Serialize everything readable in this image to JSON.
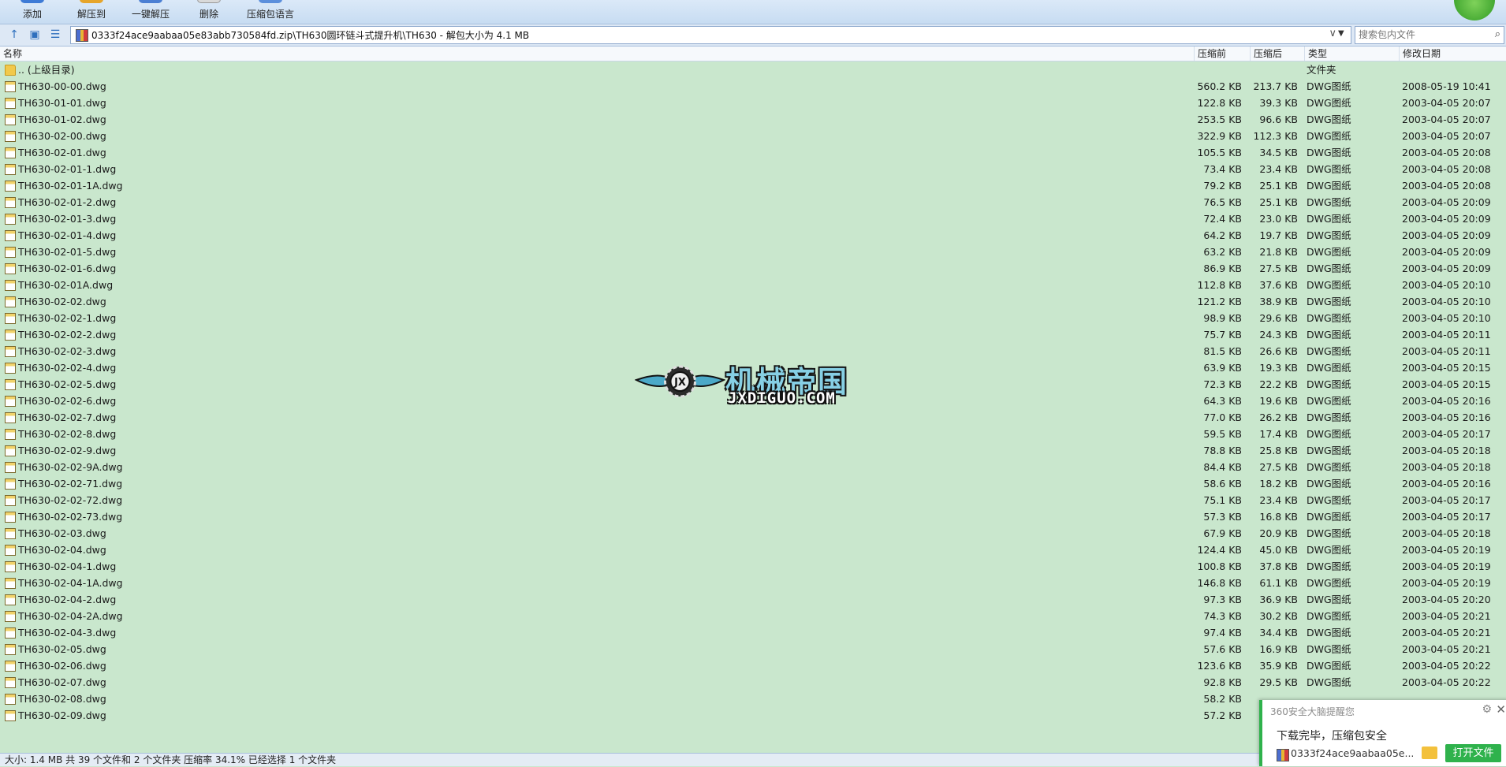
{
  "toolbar": {
    "buttons": [
      {
        "label": "添加",
        "icon": "add-icon"
      },
      {
        "label": "解压到",
        "icon": "extract-to-icon"
      },
      {
        "label": "一键解压",
        "icon": "one-click-extract-icon"
      },
      {
        "label": "删除",
        "icon": "delete-icon"
      },
      {
        "label": "压缩包语言",
        "icon": "archive-language-icon"
      }
    ]
  },
  "address": {
    "path": "0333f24ace9aabaa05e83abb730584fd.zip\\TH630圆环链斗式提升机\\TH630 - 解包大小为 4.1 MB",
    "search_placeholder": "搜索包内文件"
  },
  "columns": {
    "name": "名称",
    "packed": "压缩前",
    "compressed": "压缩后",
    "type": "类型",
    "modified": "修改日期"
  },
  "parent_row": {
    "name": ".. (上级目录)",
    "type": "文件夹"
  },
  "files": [
    {
      "name": "TH630-00-00.dwg",
      "packed": "560.2 KB",
      "compressed": "213.7 KB",
      "type": "DWG图纸",
      "modified": "2008-05-19 10:41"
    },
    {
      "name": "TH630-01-01.dwg",
      "packed": "122.8 KB",
      "compressed": "39.3 KB",
      "type": "DWG图纸",
      "modified": "2003-04-05 20:07"
    },
    {
      "name": "TH630-01-02.dwg",
      "packed": "253.5 KB",
      "compressed": "96.6 KB",
      "type": "DWG图纸",
      "modified": "2003-04-05 20:07"
    },
    {
      "name": "TH630-02-00.dwg",
      "packed": "322.9 KB",
      "compressed": "112.3 KB",
      "type": "DWG图纸",
      "modified": "2003-04-05 20:07"
    },
    {
      "name": "TH630-02-01.dwg",
      "packed": "105.5 KB",
      "compressed": "34.5 KB",
      "type": "DWG图纸",
      "modified": "2003-04-05 20:08"
    },
    {
      "name": "TH630-02-01-1.dwg",
      "packed": "73.4 KB",
      "compressed": "23.4 KB",
      "type": "DWG图纸",
      "modified": "2003-04-05 20:08"
    },
    {
      "name": "TH630-02-01-1A.dwg",
      "packed": "79.2 KB",
      "compressed": "25.1 KB",
      "type": "DWG图纸",
      "modified": "2003-04-05 20:08"
    },
    {
      "name": "TH630-02-01-2.dwg",
      "packed": "76.5 KB",
      "compressed": "25.1 KB",
      "type": "DWG图纸",
      "modified": "2003-04-05 20:09"
    },
    {
      "name": "TH630-02-01-3.dwg",
      "packed": "72.4 KB",
      "compressed": "23.0 KB",
      "type": "DWG图纸",
      "modified": "2003-04-05 20:09"
    },
    {
      "name": "TH630-02-01-4.dwg",
      "packed": "64.2 KB",
      "compressed": "19.7 KB",
      "type": "DWG图纸",
      "modified": "2003-04-05 20:09"
    },
    {
      "name": "TH630-02-01-5.dwg",
      "packed": "63.2 KB",
      "compressed": "21.8 KB",
      "type": "DWG图纸",
      "modified": "2003-04-05 20:09"
    },
    {
      "name": "TH630-02-01-6.dwg",
      "packed": "86.9 KB",
      "compressed": "27.5 KB",
      "type": "DWG图纸",
      "modified": "2003-04-05 20:09"
    },
    {
      "name": "TH630-02-01A.dwg",
      "packed": "112.8 KB",
      "compressed": "37.6 KB",
      "type": "DWG图纸",
      "modified": "2003-04-05 20:10"
    },
    {
      "name": "TH630-02-02.dwg",
      "packed": "121.2 KB",
      "compressed": "38.9 KB",
      "type": "DWG图纸",
      "modified": "2003-04-05 20:10"
    },
    {
      "name": "TH630-02-02-1.dwg",
      "packed": "98.9 KB",
      "compressed": "29.6 KB",
      "type": "DWG图纸",
      "modified": "2003-04-05 20:10"
    },
    {
      "name": "TH630-02-02-2.dwg",
      "packed": "75.7 KB",
      "compressed": "24.3 KB",
      "type": "DWG图纸",
      "modified": "2003-04-05 20:11"
    },
    {
      "name": "TH630-02-02-3.dwg",
      "packed": "81.5 KB",
      "compressed": "26.6 KB",
      "type": "DWG图纸",
      "modified": "2003-04-05 20:11"
    },
    {
      "name": "TH630-02-02-4.dwg",
      "packed": "63.9 KB",
      "compressed": "19.3 KB",
      "type": "DWG图纸",
      "modified": "2003-04-05 20:15"
    },
    {
      "name": "TH630-02-02-5.dwg",
      "packed": "72.3 KB",
      "compressed": "22.2 KB",
      "type": "DWG图纸",
      "modified": "2003-04-05 20:15"
    },
    {
      "name": "TH630-02-02-6.dwg",
      "packed": "64.3 KB",
      "compressed": "19.6 KB",
      "type": "DWG图纸",
      "modified": "2003-04-05 20:16"
    },
    {
      "name": "TH630-02-02-7.dwg",
      "packed": "77.0 KB",
      "compressed": "26.2 KB",
      "type": "DWG图纸",
      "modified": "2003-04-05 20:16"
    },
    {
      "name": "TH630-02-02-8.dwg",
      "packed": "59.5 KB",
      "compressed": "17.4 KB",
      "type": "DWG图纸",
      "modified": "2003-04-05 20:17"
    },
    {
      "name": "TH630-02-02-9.dwg",
      "packed": "78.8 KB",
      "compressed": "25.8 KB",
      "type": "DWG图纸",
      "modified": "2003-04-05 20:18"
    },
    {
      "name": "TH630-02-02-9A.dwg",
      "packed": "84.4 KB",
      "compressed": "27.5 KB",
      "type": "DWG图纸",
      "modified": "2003-04-05 20:18"
    },
    {
      "name": "TH630-02-02-71.dwg",
      "packed": "58.6 KB",
      "compressed": "18.2 KB",
      "type": "DWG图纸",
      "modified": "2003-04-05 20:16"
    },
    {
      "name": "TH630-02-02-72.dwg",
      "packed": "75.1 KB",
      "compressed": "23.4 KB",
      "type": "DWG图纸",
      "modified": "2003-04-05 20:17"
    },
    {
      "name": "TH630-02-02-73.dwg",
      "packed": "57.3 KB",
      "compressed": "16.8 KB",
      "type": "DWG图纸",
      "modified": "2003-04-05 20:17"
    },
    {
      "name": "TH630-02-03.dwg",
      "packed": "67.9 KB",
      "compressed": "20.9 KB",
      "type": "DWG图纸",
      "modified": "2003-04-05 20:18"
    },
    {
      "name": "TH630-02-04.dwg",
      "packed": "124.4 KB",
      "compressed": "45.0 KB",
      "type": "DWG图纸",
      "modified": "2003-04-05 20:19"
    },
    {
      "name": "TH630-02-04-1.dwg",
      "packed": "100.8 KB",
      "compressed": "37.8 KB",
      "type": "DWG图纸",
      "modified": "2003-04-05 20:19"
    },
    {
      "name": "TH630-02-04-1A.dwg",
      "packed": "146.8 KB",
      "compressed": "61.1 KB",
      "type": "DWG图纸",
      "modified": "2003-04-05 20:19"
    },
    {
      "name": "TH630-02-04-2.dwg",
      "packed": "97.3 KB",
      "compressed": "36.9 KB",
      "type": "DWG图纸",
      "modified": "2003-04-05 20:20"
    },
    {
      "name": "TH630-02-04-2A.dwg",
      "packed": "74.3 KB",
      "compressed": "30.2 KB",
      "type": "DWG图纸",
      "modified": "2003-04-05 20:21"
    },
    {
      "name": "TH630-02-04-3.dwg",
      "packed": "97.4 KB",
      "compressed": "34.4 KB",
      "type": "DWG图纸",
      "modified": "2003-04-05 20:21"
    },
    {
      "name": "TH630-02-05.dwg",
      "packed": "57.6 KB",
      "compressed": "16.9 KB",
      "type": "DWG图纸",
      "modified": "2003-04-05 20:21"
    },
    {
      "name": "TH630-02-06.dwg",
      "packed": "123.6 KB",
      "compressed": "35.9 KB",
      "type": "DWG图纸",
      "modified": "2003-04-05 20:22"
    },
    {
      "name": "TH630-02-07.dwg",
      "packed": "92.8 KB",
      "compressed": "29.5 KB",
      "type": "DWG图纸",
      "modified": "2003-04-05 20:22"
    },
    {
      "name": "TH630-02-08.dwg",
      "packed": "58.2 KB",
      "compressed": "",
      "type": "",
      "modified": ""
    },
    {
      "name": "TH630-02-09.dwg",
      "packed": "57.2 KB",
      "compressed": "",
      "type": "",
      "modified": ""
    }
  ],
  "watermark": {
    "cn": "机械帝国",
    "en": "JXDIGUO.COM"
  },
  "status": {
    "text": "大小: 1.4 MB 共 39 个文件和 2 个文件夹 压缩率 34.1% 已经选择 1 个文件夹"
  },
  "toast": {
    "title": "360安全大脑提醒您",
    "message": "下载完毕，压缩包安全",
    "file": "0333f24ace9aabaa05e...",
    "open_button": "打开文件"
  },
  "colors": {
    "list_bg": "#c9e7cd",
    "accent_green": "#2fb24c",
    "toolbar_bg": "#dbe9f8"
  }
}
